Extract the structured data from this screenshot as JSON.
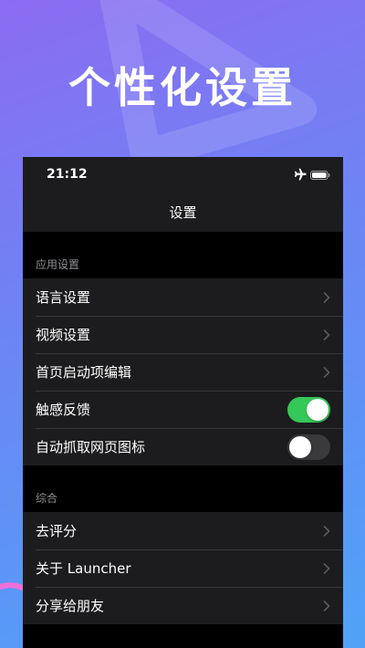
{
  "promo": {
    "headline": "个性化设置"
  },
  "status_bar": {
    "time": "21:12",
    "airplane_icon": "airplane-icon",
    "battery_icon": "battery-icon"
  },
  "nav": {
    "title": "设置"
  },
  "sections": {
    "app": {
      "header": "应用设置",
      "items": [
        {
          "label": "语言设置",
          "kind": "disclosure"
        },
        {
          "label": "视频设置",
          "kind": "disclosure"
        },
        {
          "label": "首页启动项编辑",
          "kind": "disclosure"
        },
        {
          "label": "触感反馈",
          "kind": "toggle",
          "on": true
        },
        {
          "label": "自动抓取网页图标",
          "kind": "toggle",
          "on": false
        }
      ]
    },
    "general": {
      "header": "综合",
      "items": [
        {
          "label": "去评分",
          "kind": "disclosure"
        },
        {
          "label": "关于 Launcher",
          "kind": "disclosure"
        },
        {
          "label": "分享给朋友",
          "kind": "disclosure"
        }
      ]
    }
  },
  "colors": {
    "toggle_on": "#34c759",
    "toggle_off": "#3a3a3c",
    "cell_background": "#1c1c1e",
    "page_background": "#000000",
    "gradient_top": "#8b6cf2",
    "gradient_bottom": "#4fa3f7"
  }
}
